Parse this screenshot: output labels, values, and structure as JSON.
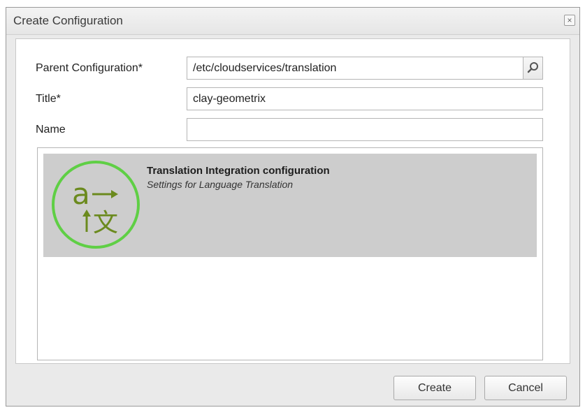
{
  "window": {
    "title": "Create Configuration",
    "close_glyph": "×"
  },
  "form": {
    "parent": {
      "label": "Parent Configuration*",
      "value": "/etc/cloudservices/translation"
    },
    "title": {
      "label": "Title*",
      "value": "clay-geometrix"
    },
    "name": {
      "label": "Name",
      "value": ""
    }
  },
  "templates": {
    "items": [
      {
        "title": "Translation Integration configuration",
        "description": "Settings for Language Translation",
        "icon": "translation-icon"
      }
    ]
  },
  "footer": {
    "create_label": "Create",
    "cancel_label": "Cancel"
  },
  "colors": {
    "icon_ring": "#5fcf45",
    "icon_glyph": "#6b8a1e"
  }
}
